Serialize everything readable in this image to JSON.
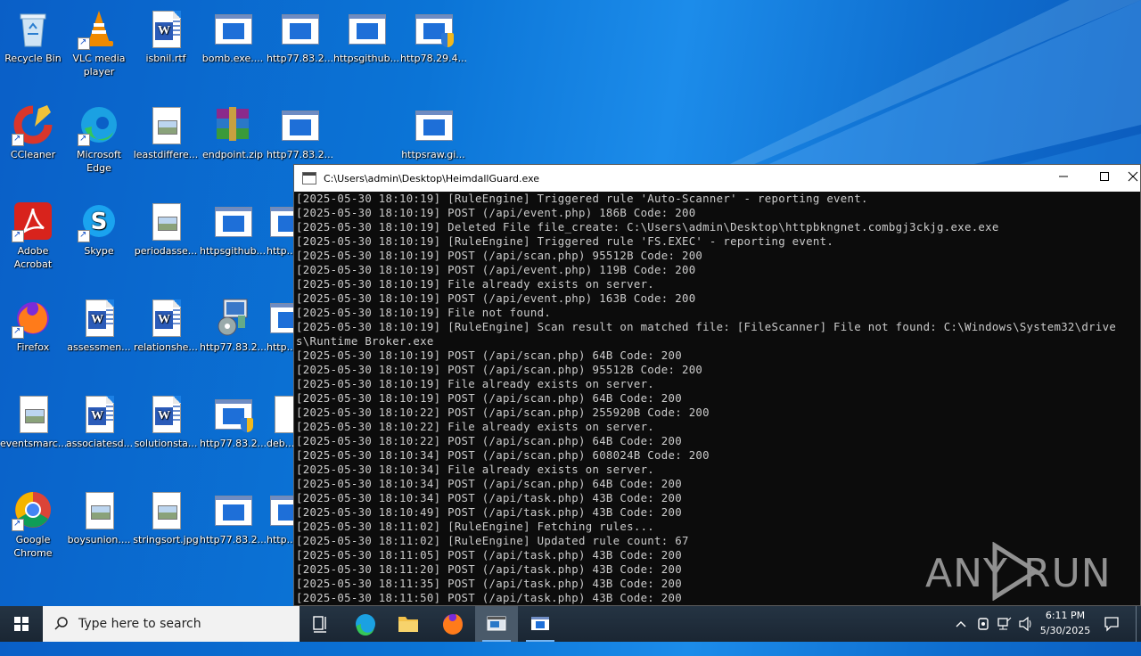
{
  "desktop": {
    "icons": [
      {
        "label": "Recycle Bin"
      },
      {
        "label": "VLC media player"
      },
      {
        "label": "isbnil.rtf"
      },
      {
        "label": "bomb.exe...."
      },
      {
        "label": "http77.83.2..."
      },
      {
        "label": "httpsgithub..."
      },
      {
        "label": "http78.29.4..."
      },
      {
        "label": "CCleaner"
      },
      {
        "label": "Microsoft Edge"
      },
      {
        "label": "leastdiffere..."
      },
      {
        "label": "endpoint.zip"
      },
      {
        "label": "http77.83.2..."
      },
      {
        "label": "httpsraw.gi..."
      },
      {
        "label": "Adobe Acrobat"
      },
      {
        "label": "Skype"
      },
      {
        "label": "periodasse..."
      },
      {
        "label": "httpsgithub..."
      },
      {
        "label": "http..."
      },
      {
        "label": "Firefox"
      },
      {
        "label": "assessmen..."
      },
      {
        "label": "relationshe..."
      },
      {
        "label": "http77.83.2..."
      },
      {
        "label": "http..."
      },
      {
        "label": "eventsmarc..."
      },
      {
        "label": "associatesd..."
      },
      {
        "label": "solutionsta..."
      },
      {
        "label": "http77.83.2..."
      },
      {
        "label": "deb..."
      },
      {
        "label": "Google Chrome"
      },
      {
        "label": "boysunion...."
      },
      {
        "label": "stringsort.jpg"
      },
      {
        "label": "http77.83.2..."
      },
      {
        "label": "http..."
      }
    ]
  },
  "console": {
    "title": "C:\\Users\\admin\\Desktop\\HeimdallGuard.exe",
    "lines": [
      "[2025-05-30 18:10:19] [RuleEngine] Triggered rule 'Auto-Scanner' - reporting event.",
      "[2025-05-30 18:10:19] POST (/api/event.php) 186B Code: 200",
      "[2025-05-30 18:10:19] Deleted File file_create: C:\\Users\\admin\\Desktop\\httpbkngnet.combgj3ckjg.exe.exe",
      "[2025-05-30 18:10:19] [RuleEngine] Triggered rule 'FS.EXEC' - reporting event.",
      "[2025-05-30 18:10:19] POST (/api/scan.php) 95512B Code: 200",
      "[2025-05-30 18:10:19] POST (/api/event.php) 119B Code: 200",
      "[2025-05-30 18:10:19] File already exists on server.",
      "[2025-05-30 18:10:19] POST (/api/event.php) 163B Code: 200",
      "[2025-05-30 18:10:19] File not found.",
      "[2025-05-30 18:10:19] [RuleEngine] Scan result on matched file: [FileScanner] File not found: C:\\Windows\\System32\\drive",
      "s\\Runtime Broker.exe",
      "[2025-05-30 18:10:19] POST (/api/scan.php) 64B Code: 200",
      "[2025-05-30 18:10:19] POST (/api/scan.php) 95512B Code: 200",
      "[2025-05-30 18:10:19] File already exists on server.",
      "[2025-05-30 18:10:19] POST (/api/scan.php) 64B Code: 200",
      "[2025-05-30 18:10:22] POST (/api/scan.php) 255920B Code: 200",
      "[2025-05-30 18:10:22] File already exists on server.",
      "[2025-05-30 18:10:22] POST (/api/scan.php) 64B Code: 200",
      "[2025-05-30 18:10:34] POST (/api/scan.php) 608024B Code: 200",
      "[2025-05-30 18:10:34] File already exists on server.",
      "[2025-05-30 18:10:34] POST (/api/scan.php) 64B Code: 200",
      "[2025-05-30 18:10:34] POST (/api/task.php) 43B Code: 200",
      "[2025-05-30 18:10:49] POST (/api/task.php) 43B Code: 200",
      "[2025-05-30 18:11:02] [RuleEngine] Fetching rules...",
      "[2025-05-30 18:11:02] [RuleEngine] Updated rule count: 67",
      "[2025-05-30 18:11:05] POST (/api/task.php) 43B Code: 200",
      "[2025-05-30 18:11:20] POST (/api/task.php) 43B Code: 200",
      "[2025-05-30 18:11:35] POST (/api/task.php) 43B Code: 200",
      "[2025-05-30 18:11:50] POST (/api/task.php) 43B Code: 200"
    ]
  },
  "taskbar": {
    "search_placeholder": "Type here to search",
    "time": "6:11 PM",
    "date": "5/30/2025"
  },
  "watermark": {
    "left": "ANY",
    "right": "RUN"
  }
}
